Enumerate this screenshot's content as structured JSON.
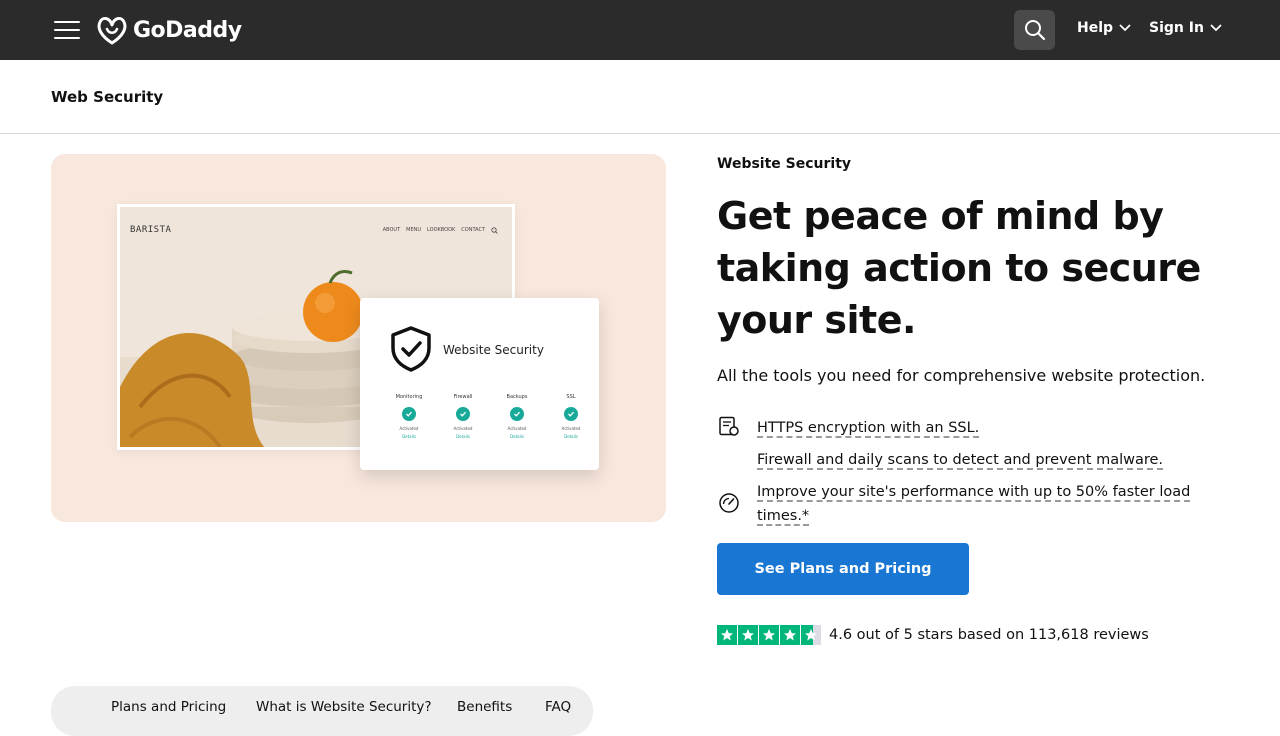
{
  "header": {
    "logo_text": "GoDaddy",
    "help_label": "Help",
    "signin_label": "Sign In"
  },
  "subheader": {
    "title": "Web Security"
  },
  "illustration": {
    "brand": "BARISTA",
    "nav": [
      "ABOUT",
      "MENU",
      "LOOKBOOK",
      "CONTACT"
    ],
    "card_title": "Website Security",
    "columns": [
      {
        "label": "Monitoring",
        "status": "Activated",
        "link": "Details"
      },
      {
        "label": "Firewall",
        "status": "Activated",
        "link": "Details"
      },
      {
        "label": "Backups",
        "status": "Activated",
        "link": "Details"
      },
      {
        "label": "SSL",
        "status": "Activated",
        "link": "Details"
      }
    ]
  },
  "hero": {
    "eyebrow": "Website Security",
    "headline": "Get peace of mind by taking action to secure your site.",
    "lead": "All the tools you need for comprehensive website protection.",
    "features": [
      {
        "icon": "certificate-icon",
        "text": "HTTPS encryption with an SSL."
      },
      {
        "icon": "",
        "text": "Firewall and daily scans to detect and prevent malware."
      },
      {
        "icon": "speedometer-icon",
        "text": "Improve your site's performance with up to 50% faster load times.*"
      }
    ],
    "cta_label": "See Plans and Pricing",
    "rating_text": "4.6 out of 5 stars based on 113,618 reviews",
    "rating_value": 4.6
  },
  "anchor_nav": {
    "items": [
      "Plans and Pricing",
      "What is Website Security?",
      "Benefits",
      "FAQ"
    ]
  },
  "colors": {
    "topbar": "#2b2b2b",
    "cta": "#1976d2",
    "trustpilot_green": "#00b67a",
    "hero_bg": "#f8e7dd"
  }
}
